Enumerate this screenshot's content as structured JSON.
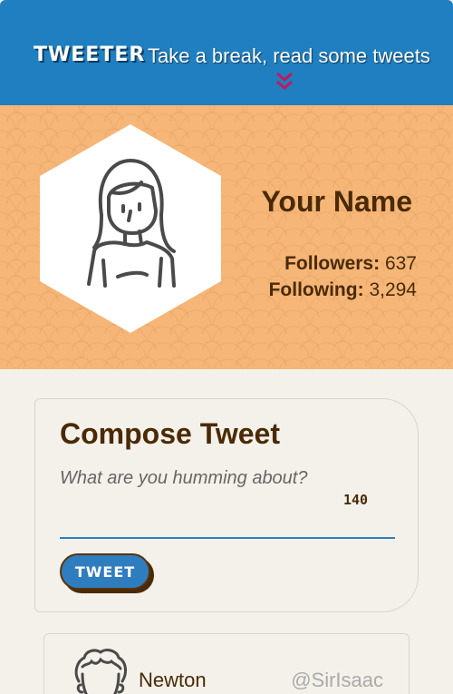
{
  "header": {
    "logo": "TWEETER",
    "tagline": "Take a break, read some tweets",
    "scroll_icon": "double-chevron-down-icon"
  },
  "profile": {
    "name": "Your Name",
    "followers_label": "Followers:",
    "followers_value": "637",
    "following_label": "Following:",
    "following_value": "3,294",
    "avatar_icon": "user-avatar-icon"
  },
  "compose": {
    "title": "Compose Tweet",
    "placeholder": "What are you humming about?",
    "counter": "140",
    "button_label": "TWEET"
  },
  "tweets": [
    {
      "name": "Newton",
      "handle": "@SirIsaac",
      "avatar_icon": "curly-hair-avatar-icon"
    }
  ],
  "colors": {
    "header_bg": "#1f7fc0",
    "profile_bg": "#f5b677",
    "page_bg": "#f4f1ea",
    "text_brown": "#4a2a06",
    "accent_blue": "#2e7dbf"
  }
}
